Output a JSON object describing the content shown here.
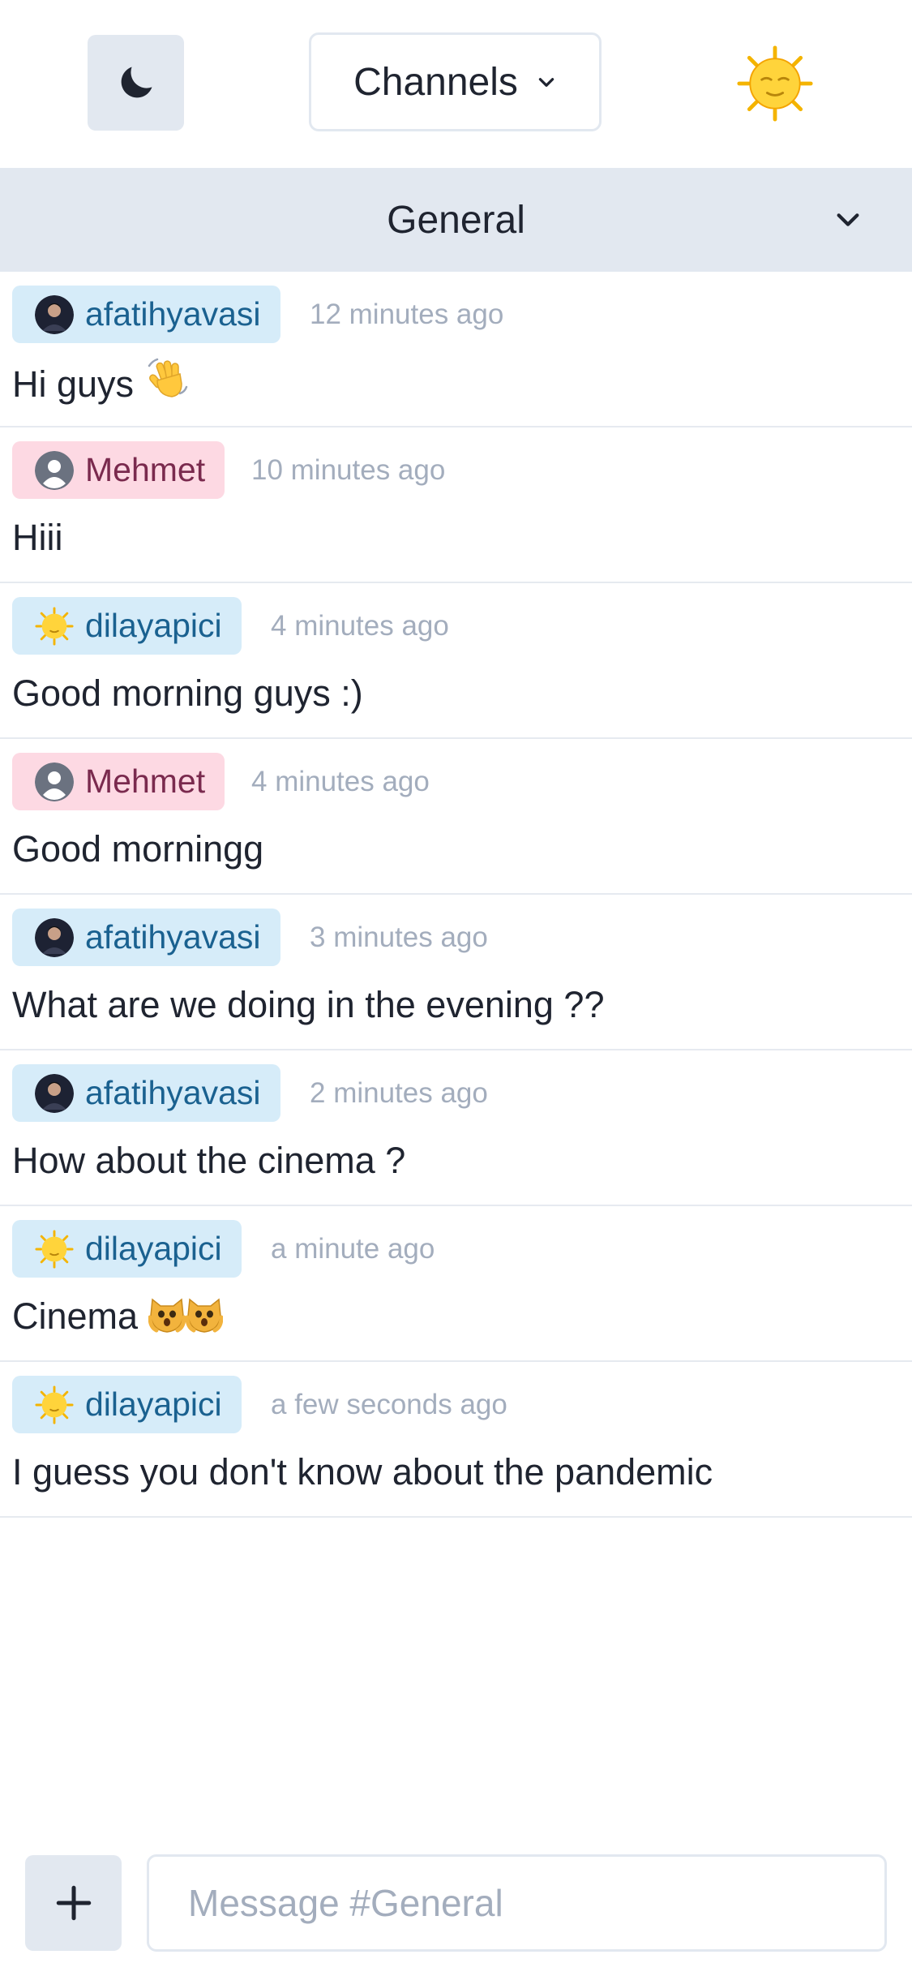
{
  "header": {
    "theme_toggle_icon": "moon-icon",
    "channels_button": {
      "label": "Channels",
      "icon": "chevron-down-icon"
    },
    "user_avatar_icon": "sun-face-icon"
  },
  "channel": {
    "name": "General",
    "toggle_icon": "chevron-down-icon"
  },
  "messages": [
    {
      "user": "afatihyavasi",
      "avatar": "photo-avatar",
      "chip_color": "#d6ecf9",
      "time": "12 minutes ago",
      "text": "Hi guys",
      "emoji": "waving-hand-emoji"
    },
    {
      "user": "Mehmet",
      "avatar": "default-user-icon",
      "chip_color": "#fdd9e3",
      "time": "10 minutes ago",
      "text": "Hiii",
      "emoji": ""
    },
    {
      "user": "dilayapici",
      "avatar": "sun-face-icon",
      "chip_color": "#d6ecf9",
      "time": "4 minutes ago",
      "text": "Good morning guys :)",
      "emoji": ""
    },
    {
      "user": "Mehmet",
      "avatar": "default-user-icon",
      "chip_color": "#fdd9e3",
      "time": "4 minutes ago",
      "text": "Good morningg",
      "emoji": ""
    },
    {
      "user": "afatihyavasi",
      "avatar": "photo-avatar",
      "chip_color": "#d6ecf9",
      "time": "3 minutes ago",
      "text": "What are we doing in the evening ??",
      "emoji": ""
    },
    {
      "user": "afatihyavasi",
      "avatar": "photo-avatar",
      "chip_color": "#d6ecf9",
      "time": "2 minutes ago",
      "text": "How about the cinema ?",
      "emoji": ""
    },
    {
      "user": "dilayapici",
      "avatar": "sun-face-icon",
      "chip_color": "#d6ecf9",
      "time": "a minute ago",
      "text": "Cinema",
      "emoji": "weary-cat-emoji x2"
    },
    {
      "user": "dilayapici",
      "avatar": "sun-face-icon",
      "chip_color": "#d6ecf9",
      "time": "a few seconds ago",
      "text": "I guess you don't know about the pandemic",
      "emoji": ""
    }
  ],
  "composer": {
    "add_icon": "plus-icon",
    "placeholder": "Message #General"
  },
  "colors": {
    "button_bg": "#e2e8f0",
    "chip_blue": "#d6ecf9",
    "chip_pink": "#fdd9e3",
    "name_blue": "#1a6190",
    "name_pink": "#7a2a4e",
    "muted": "#a3adbd",
    "text": "#1f2430"
  }
}
